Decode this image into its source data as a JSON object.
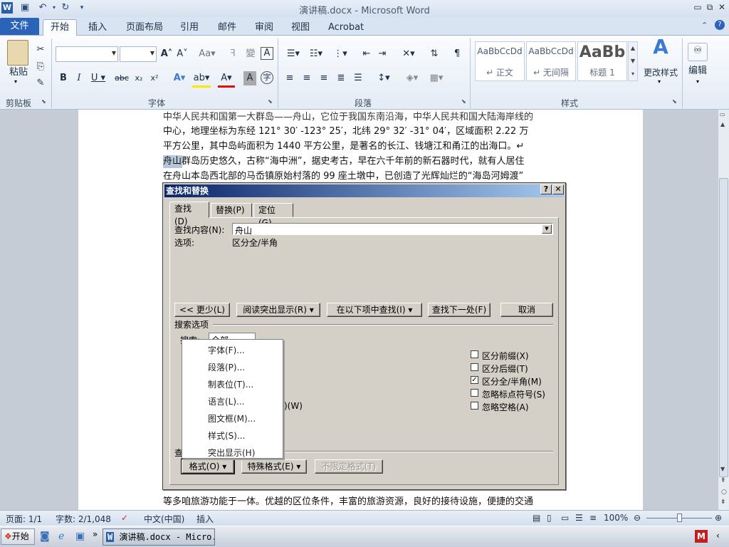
{
  "window": {
    "title": "演讲稿.docx - Microsoft Word"
  },
  "tabs": {
    "file": "文件",
    "items": [
      "开始",
      "插入",
      "页面布局",
      "引用",
      "邮件",
      "审阅",
      "视图",
      "Acrobat"
    ],
    "active": "开始"
  },
  "ribbon": {
    "clipboard": {
      "paste": "粘贴",
      "label": "剪贴板"
    },
    "font": {
      "label": "字体"
    },
    "paragraph": {
      "label": "段落"
    },
    "styles": {
      "label": "样式",
      "items": [
        {
          "sample": "AaBbCcDd",
          "name": "↵ 正文"
        },
        {
          "sample": "AaBbCcDd",
          "name": "↵ 无间隔"
        },
        {
          "sample": "AaBb",
          "name": "标题 1"
        }
      ],
      "change": "更改样式"
    },
    "editing": {
      "label": "编辑"
    }
  },
  "document": {
    "lines": [
      "中华人民共和国第一大群岛——舟山，它位于我国东南沿海，中华人民共和国大陆海岸线的",
      "中心，地理坐标为东经 121° 30′ -123° 25′，北纬 29° 32′ -31° 04′，区域面积 2.22 万",
      "平方公里，其中岛屿面积为 1440 平方公里，是著名的长江、钱塘江和甬江的出海口。↵",
      "舟山群岛历史悠久，古称“海中洲”，据史考古，早在六千年前的新石器时代，就有人居住",
      "在舟山本岛西北部的马岙镇原始村落的 99 座土墩中，已创造了光辉灿烂的“海岛河姆渡”"
    ],
    "last_line": "等多咱旅游功能于一体。优越的区位条件，丰富的旅游资源，良好的接待设施，便捷的交通",
    "highlight": "舟山"
  },
  "dialog": {
    "title": "查找和替换",
    "help": "?",
    "close": "✕",
    "tabs": [
      "查找(D)",
      "替换(P)",
      "定位(G)"
    ],
    "find_label": "查找内容(N):",
    "find_value": "舟山",
    "options_label": "选项:",
    "options_value": "区分全/半角",
    "buttons": {
      "less": "<< 更少(L)",
      "reading_highlight": "阅读突出显示(R) ▾",
      "find_in": "在以下项中查找(I) ▾",
      "find_next": "查找下一处(F)",
      "cancel": "取消"
    },
    "search_options_label": "搜索选项",
    "search_label": "搜索:",
    "search_value": "全部",
    "partial_text": "文)(W)",
    "find_partial": "查",
    "checkboxes": [
      {
        "label": "区分前缀(X)",
        "checked": false
      },
      {
        "label": "区分后缀(T)",
        "checked": false
      },
      {
        "label": "区分全/半角(M)",
        "checked": true
      },
      {
        "label": "忽略标点符号(S)",
        "checked": false
      },
      {
        "label": "忽略空格(A)",
        "checked": false
      }
    ],
    "bottom_buttons": {
      "format": "格式(O) ▾",
      "special": "特殊格式(E) ▾",
      "no_format": "不限定格式(T)"
    }
  },
  "format_menu": {
    "items": [
      "字体(F)...",
      "段落(P)...",
      "制表位(T)...",
      "语言(L)...",
      "图文框(M)...",
      "样式(S)...",
      "突出显示(H)"
    ]
  },
  "status": {
    "page": "页面: 1/1",
    "words": "字数: 2/1,048",
    "language": "中文(中国)",
    "mode": "插入",
    "zoom": "100%"
  },
  "taskbar": {
    "start": "开始",
    "task": "演讲稿.docx - Micro..."
  }
}
